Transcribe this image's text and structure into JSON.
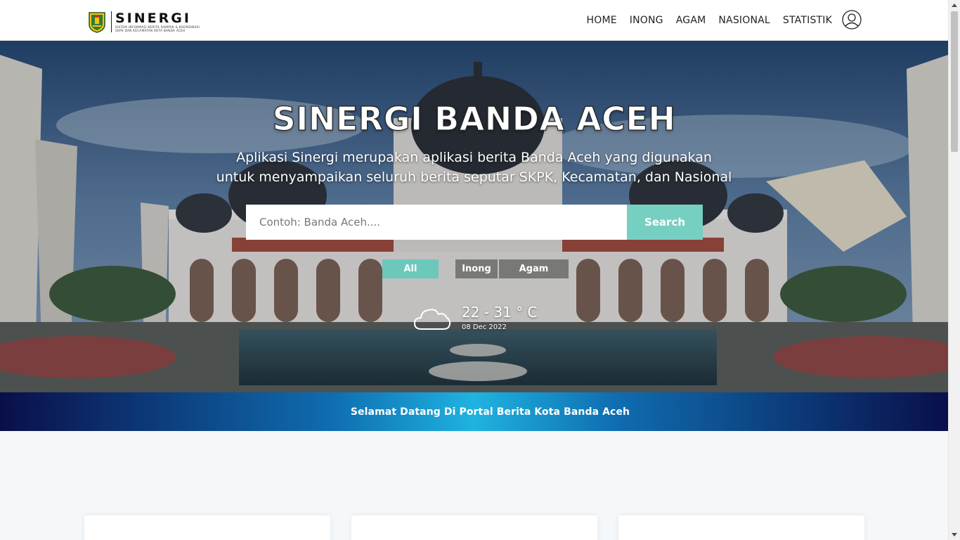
{
  "brand": {
    "title": "SINERGI",
    "subtitle_line1": "SISTEM INFORMASI BERITA DAMPAK & KOORDINASI",
    "subtitle_line2": "SKPK DAN KECAMATAN KOTA BANDA ACEH"
  },
  "nav": {
    "items": [
      {
        "label": "HOME"
      },
      {
        "label": "INONG"
      },
      {
        "label": "AGAM"
      },
      {
        "label": "NASIONAL"
      },
      {
        "label": "STATISTIK"
      }
    ],
    "user_icon": "user-circle-icon"
  },
  "hero": {
    "title": "SINERGI BANDA ACEH",
    "description_line1": "Aplikasi Sinergi merupakan aplikasi berita Banda Aceh yang digunakan",
    "description_line2": "untuk menyampaikan seluruh berita seputar SKPK, Kecamatan, dan Nasional",
    "search": {
      "placeholder": "Contoh: Banda Aceh....",
      "button_label": "Search"
    },
    "filters": [
      {
        "label": "All",
        "active": true
      },
      {
        "label": "Inong",
        "active": false
      },
      {
        "label": "Agam",
        "active": false
      }
    ],
    "weather": {
      "icon": "cloud-icon",
      "temperature": "22 - 31 ° C",
      "date": "08 Dec 2022"
    }
  },
  "banner": {
    "text": "Selamat Datang Di Portal Berita Kota Banda Aceh"
  },
  "colors": {
    "accent": "#76d0c2",
    "banner_dark": "#0a0f4a",
    "banner_light": "#1fb3e0"
  }
}
